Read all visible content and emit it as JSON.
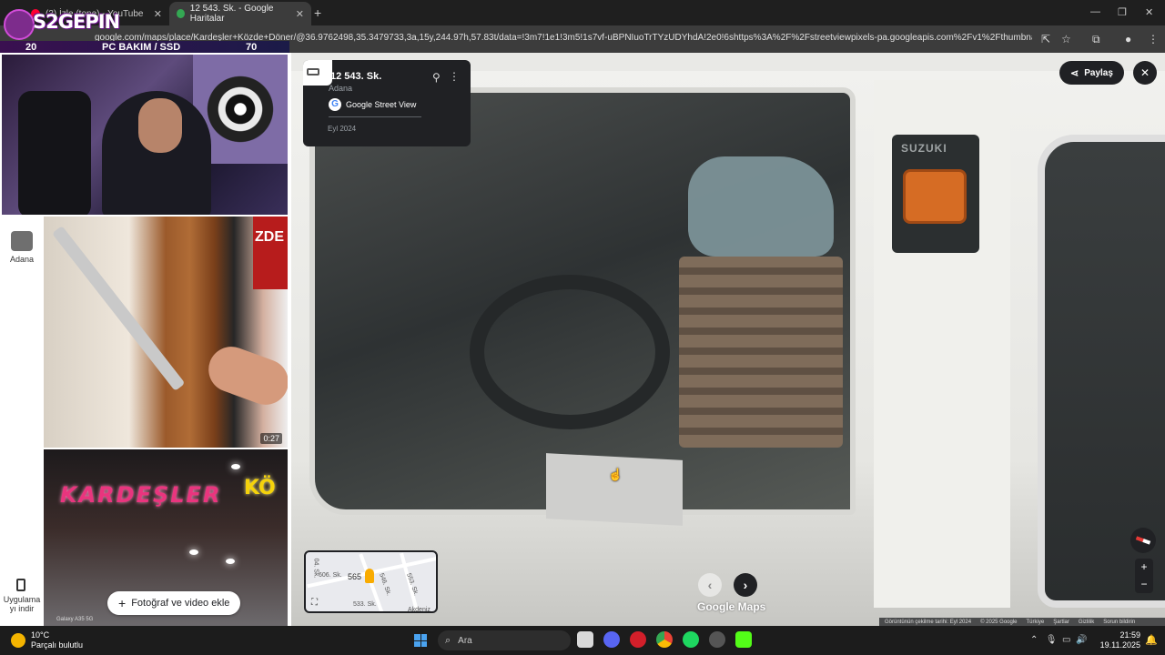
{
  "browser": {
    "tabs": [
      {
        "label": "(3) İzle (tone) - YouTube",
        "color": "#ff0033"
      },
      {
        "label": "12 543. Sk. - Google Haritalar",
        "color": "#34a853"
      }
    ],
    "url": "google.com/maps/place/Kardeşler+Közde+Döner/@36.9762498,35.3479733,3a,15y,244.97h,57.83t/data=!3m7!1e1!3m5!1s7vf-uBPNIuoTrTYzUDYhdA!2e0!6shttps%3A%2F%2Fstreetviewpixels-pa.googleapis.com%2Fv1%2Fthumbnail%3Fcb_client%3Dmap..."
  },
  "overlay": {
    "logo_text": "S2GEPIN",
    "sponsor_left_num": "20",
    "sponsor_text": "PC BAKIM / SSD",
    "sponsor_right_num": "70"
  },
  "left_panel": {
    "place_label": "Adana",
    "app_label": "Uygulama yı indir",
    "video_duration": "0:27",
    "add_photo_label": "Fotoğraf ve video ekle",
    "photo1_sign": "ZDE",
    "photo2_sign": "KARDEŞLER",
    "photo2_sign2": "KÖ",
    "camera_caption": "Galaxy A35 5G"
  },
  "streetview": {
    "title": "12 543. Sk.",
    "subtitle": "Adana",
    "source": "Google Street View",
    "date": "Eyl 2024",
    "share_label": "Paylaş",
    "brand_label": "SUZUKI",
    "gmaps_logo": "Google Maps",
    "footer": [
      "Görüntünün çekilme tarihi: Eyl 2024",
      "© 2025 Google",
      "Türkiye",
      "Şartlar",
      "Gizlilik",
      "Sorun bildirin"
    ],
    "minimap_labels": [
      "04. Sk.",
      "606. Sk.",
      "565",
      "546. Sk.",
      "553. Sk.",
      "533. Sk.",
      "Akdeniz"
    ]
  },
  "taskbar": {
    "temp": "10°C",
    "weather": "Parçalı bulutlu",
    "search_placeholder": "Ara",
    "time": "21:59",
    "date": "19.11.2025"
  }
}
